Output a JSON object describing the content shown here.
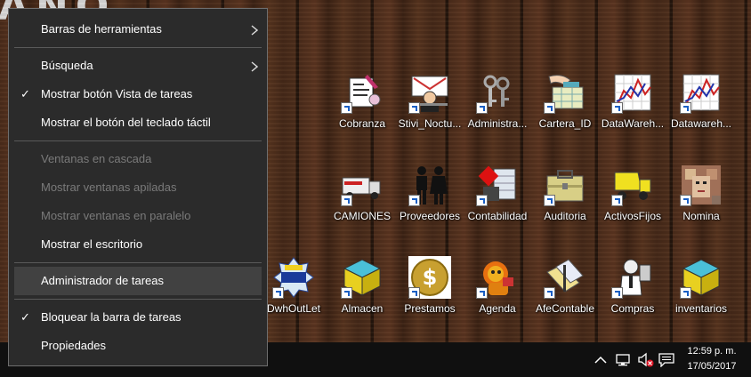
{
  "context_menu": {
    "items": [
      {
        "label": "Barras de herramientas",
        "submenu": true,
        "checked": false,
        "enabled": true
      },
      {
        "label": "Búsqueda",
        "submenu": true,
        "checked": false,
        "enabled": true
      },
      {
        "label": "Mostrar botón Vista de tareas",
        "submenu": false,
        "checked": true,
        "enabled": true
      },
      {
        "label": "Mostrar el botón del teclado táctil",
        "submenu": false,
        "checked": false,
        "enabled": true
      },
      {
        "label": "Ventanas en cascada",
        "submenu": false,
        "checked": false,
        "enabled": false
      },
      {
        "label": "Mostrar ventanas apiladas",
        "submenu": false,
        "checked": false,
        "enabled": false
      },
      {
        "label": "Mostrar ventanas en paralelo",
        "submenu": false,
        "checked": false,
        "enabled": false
      },
      {
        "label": "Mostrar el escritorio",
        "submenu": false,
        "checked": false,
        "enabled": true
      },
      {
        "label": "Administrador de tareas",
        "submenu": false,
        "checked": false,
        "enabled": true,
        "highlighted": true
      },
      {
        "label": "Bloquear la barra de tareas",
        "submenu": false,
        "checked": true,
        "enabled": true
      },
      {
        "label": "Propiedades",
        "submenu": false,
        "checked": false,
        "enabled": true
      }
    ],
    "check_glyph": "✓",
    "submenu_glyph": "›"
  },
  "desktop": {
    "icons": [
      {
        "label": "Cobranza",
        "icon": "invoice-icon"
      },
      {
        "label": "Stivi_Noctu...",
        "icon": "waiter-icon"
      },
      {
        "label": "Administra...",
        "icon": "keys-icon"
      },
      {
        "label": "Cartera_ID",
        "icon": "hand-database-icon"
      },
      {
        "label": "DataWareh...",
        "icon": "line-chart-icon"
      },
      {
        "label": "Datawareh...",
        "icon": "line-chart-icon"
      },
      {
        "label": "CAMIONES",
        "icon": "truck-icon"
      },
      {
        "label": "Proveedores",
        "icon": "people-icon"
      },
      {
        "label": "Contabilidad",
        "icon": "accounting-icon"
      },
      {
        "label": "Auditoria",
        "icon": "briefcase-icon"
      },
      {
        "label": "ActivosFijos",
        "icon": "dump-truck-icon"
      },
      {
        "label": "Nomina",
        "icon": "mosaic-face-icon"
      },
      {
        "label": "DwhOutLet",
        "icon": "super-remate-icon"
      },
      {
        "label": "Almacen",
        "icon": "cube-icon"
      },
      {
        "label": "Prestamos",
        "icon": "dollar-coin-icon"
      },
      {
        "label": "Agenda",
        "icon": "lion-icon"
      },
      {
        "label": "AfeContable",
        "icon": "folders-icon"
      },
      {
        "label": "Compras",
        "icon": "clerk-icon"
      },
      {
        "label": "inventarios",
        "icon": "cube-icon"
      }
    ]
  },
  "taskbar": {
    "time": "12:59 p. m.",
    "date": "17/05/2017",
    "tray_icons": [
      "chevron-up-icon",
      "network-icon",
      "volume-muted-icon",
      "action-center-icon"
    ]
  }
}
